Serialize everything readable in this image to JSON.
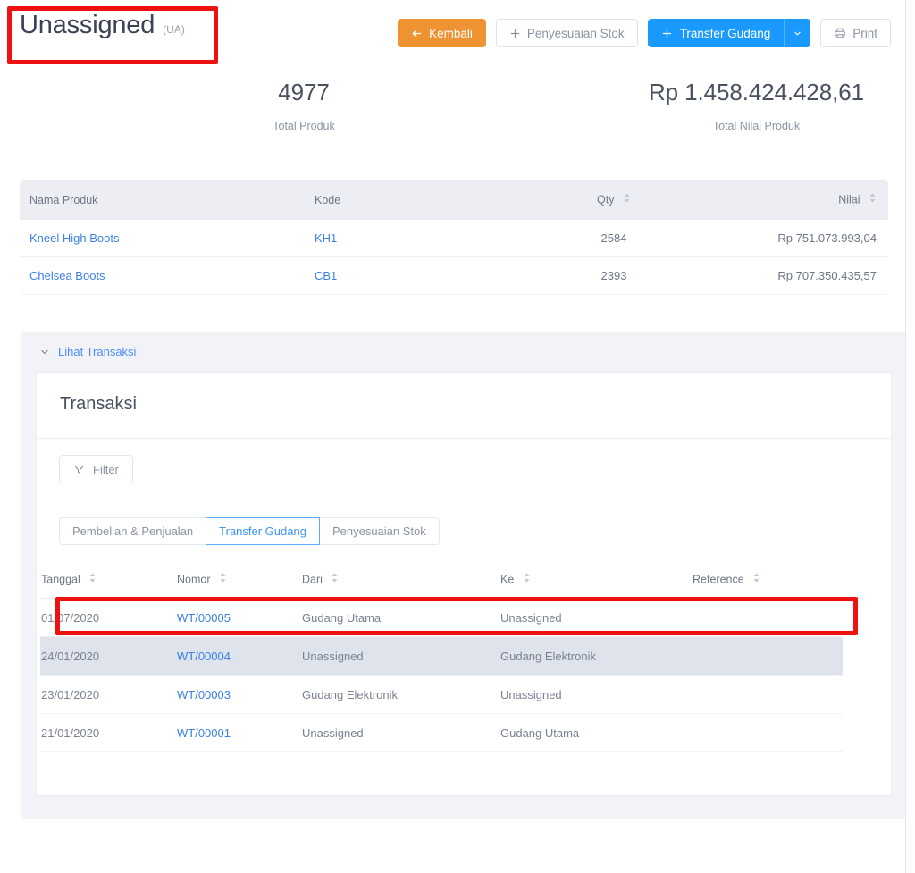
{
  "header": {
    "title": "Unassigned",
    "code": "(UA)",
    "buttons": [
      {
        "label": "Kembali",
        "icon": "arrow-left-icon",
        "style": "orange"
      },
      {
        "label": "Penyesuaian Stok",
        "icon": "plus-icon",
        "style": "white"
      },
      {
        "label": "Transfer Gudang",
        "icon": "plus-icon",
        "style": "blue",
        "caret": "chevron-down-icon"
      },
      {
        "label": "Print",
        "icon": "printer-icon",
        "style": "white"
      }
    ]
  },
  "stats": {
    "total_produk": {
      "value": "4977",
      "label": "Total Produk"
    },
    "total_nilai": {
      "value": "Rp 1.458.424.428,61",
      "label": "Total Nilai Produk"
    }
  },
  "product_table": {
    "columns": [
      {
        "label": "Nama Produk",
        "sortable": false
      },
      {
        "label": "Kode",
        "sortable": false
      },
      {
        "label": "Qty",
        "sortable": true
      },
      {
        "label": "Nilai",
        "sortable": true
      }
    ],
    "rows": [
      {
        "nama": "Kneel High Boots",
        "kode": "KH1",
        "qty": "2584",
        "nilai": "Rp 751.073.993,04"
      },
      {
        "nama": "Chelsea Boots",
        "kode": "CB1",
        "qty": "2393",
        "nilai": "Rp 707.350.435,57"
      }
    ]
  },
  "transactions": {
    "toggle_label": "Lihat Transaksi",
    "card_title": "Transaksi",
    "filter_label": "Filter",
    "tabs": [
      {
        "label": "Pembelian & Penjualan",
        "active": false
      },
      {
        "label": "Transfer Gudang",
        "active": true
      },
      {
        "label": "Penyesuaian Stok",
        "active": false
      }
    ],
    "columns": [
      {
        "label": "Tanggal",
        "sortable": true
      },
      {
        "label": "Nomor",
        "sortable": true
      },
      {
        "label": "Dari",
        "sortable": true
      },
      {
        "label": "Ke",
        "sortable": true
      },
      {
        "label": "Reference",
        "sortable": true
      }
    ],
    "rows": [
      {
        "tanggal": "01/07/2020",
        "nomor": "WT/00005",
        "dari": "Gudang Utama",
        "ke": "Unassigned",
        "reference": "",
        "highlighted": false
      },
      {
        "tanggal": "24/01/2020",
        "nomor": "WT/00004",
        "dari": "Unassigned",
        "ke": "Gudang Elektronik",
        "reference": "",
        "highlighted": true
      },
      {
        "tanggal": "23/01/2020",
        "nomor": "WT/00003",
        "dari": "Gudang Elektronik",
        "ke": "Unassigned",
        "reference": "",
        "highlighted": false
      },
      {
        "tanggal": "21/01/2020",
        "nomor": "WT/00001",
        "dari": "Unassigned",
        "ke": "Gudang Utama",
        "reference": "",
        "highlighted": false
      }
    ]
  },
  "annotations": {
    "title_box_color": "#ee1111",
    "row_box_color": "#ee1111"
  },
  "colors": {
    "accent_blue": "#1a9afe",
    "accent_orange": "#ef9232",
    "link_blue": "#3c82e6",
    "section_bg": "#f1f3f7",
    "table_head_bg": "#eceef3"
  }
}
